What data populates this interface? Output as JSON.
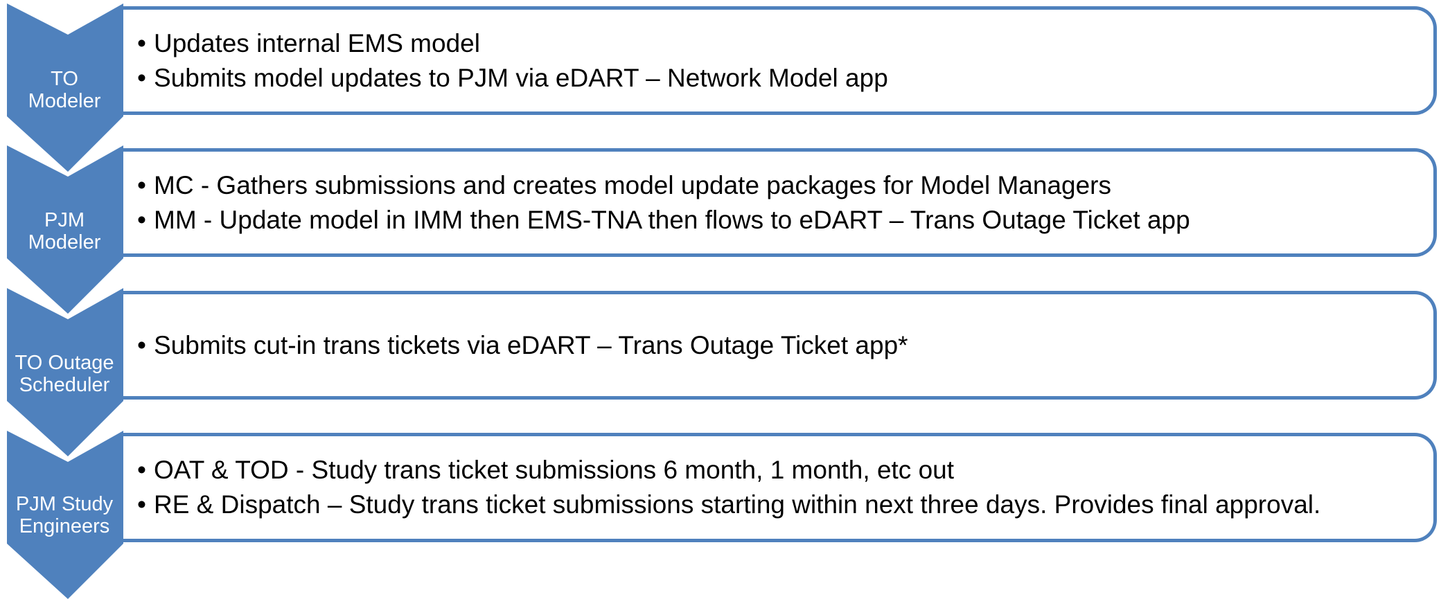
{
  "colors": {
    "chevron": "#4f81bd",
    "box_border": "#4f81bd",
    "label_text": "#ffffff",
    "text": "#000000"
  },
  "stages": [
    {
      "label": "TO\nModeler",
      "bullets": [
        "Updates internal EMS model",
        "Submits model updates to PJM via eDART – Network Model app"
      ]
    },
    {
      "label": "PJM\nModeler",
      "bullets": [
        "MC - Gathers submissions and creates model update packages for Model Managers",
        "MM - Update model in IMM then EMS-TNA then flows to eDART – Trans Outage Ticket app"
      ]
    },
    {
      "label": "TO Outage\nScheduler",
      "bullets": [
        "Submits cut-in trans tickets via eDART – Trans Outage Ticket app*"
      ]
    },
    {
      "label": "PJM Study\nEngineers",
      "bullets": [
        "OAT & TOD - Study trans ticket submissions 6 month, 1 month, etc out",
        "RE & Dispatch – Study trans ticket submissions starting within next three days.  Provides final approval."
      ]
    }
  ]
}
